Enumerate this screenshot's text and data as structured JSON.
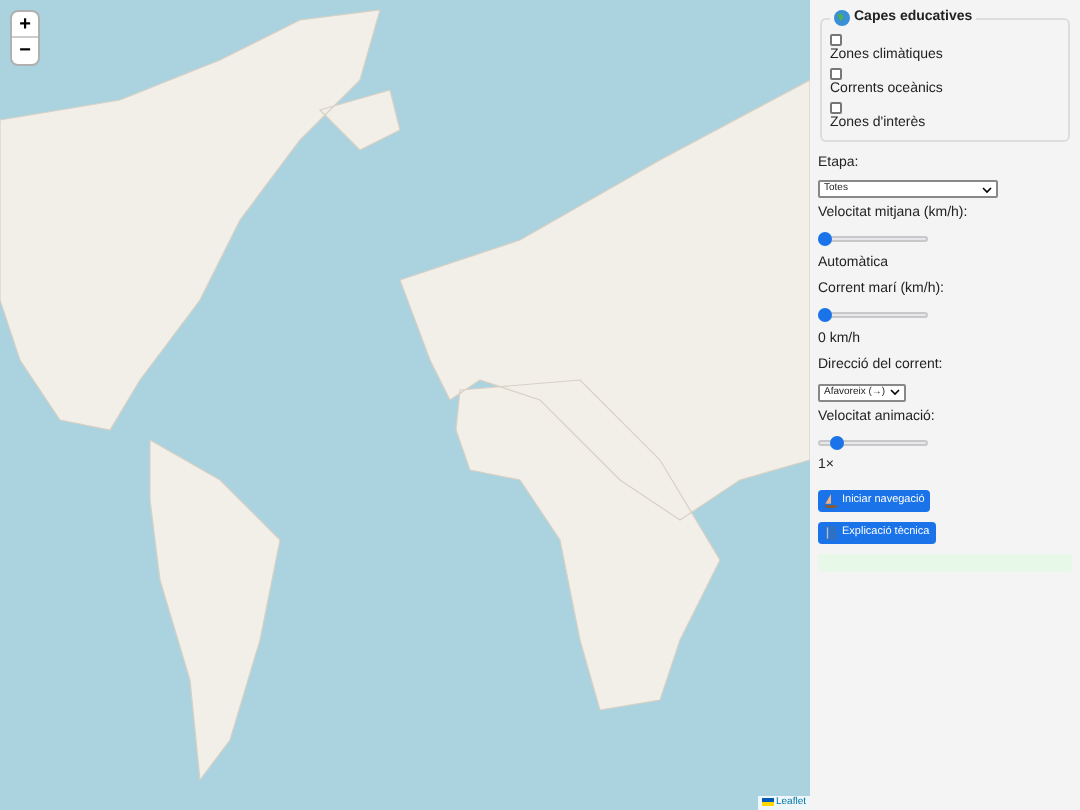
{
  "map": {
    "zoom_in": "+",
    "zoom_out": "−",
    "attribution": "Leaflet"
  },
  "layers": {
    "legend": "Capes educatives",
    "items": [
      {
        "label": "Zones climàtiques",
        "checked": false
      },
      {
        "label": "Corrents oceànics",
        "checked": false
      },
      {
        "label": "Zones d'interès",
        "checked": false
      }
    ]
  },
  "controls": [
    {
      "kind": "select",
      "label": "Etapa:",
      "value": "Totes"
    },
    {
      "kind": "slider",
      "label": "Velocitat mitjana (km/h):",
      "level": 0,
      "reading": "Automàtica"
    },
    {
      "kind": "slider",
      "label": "Corrent marí (km/h):",
      "level": 0,
      "reading": "0 km/h"
    },
    {
      "kind": "select",
      "label": "Direcció del corrent:",
      "value": "Afavoreix (→)"
    },
    {
      "kind": "slider",
      "label": "Velocitat animació:",
      "level": 0.12,
      "reading": "1×"
    }
  ],
  "buttons": [
    {
      "kind": "boat",
      "label": "Iniciar navegació"
    },
    {
      "kind": "book",
      "label": "Explicació tècnica"
    }
  ]
}
